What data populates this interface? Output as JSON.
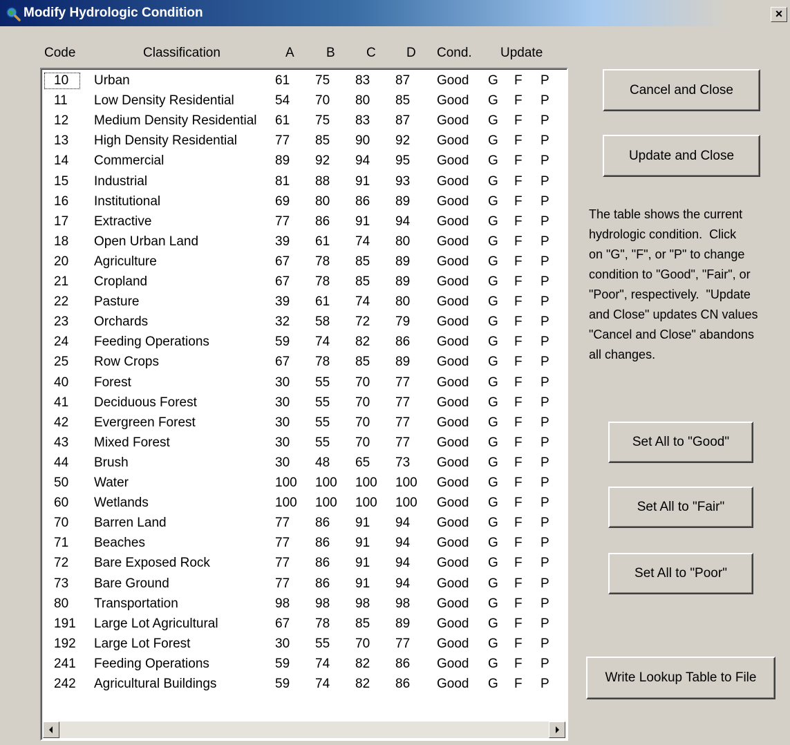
{
  "window": {
    "title": "Modify Hydrologic Condition",
    "close_glyph": "×",
    "icon": "globe-magnifier-icon"
  },
  "columns": {
    "code": "Code",
    "classification": "Classification",
    "a": "A",
    "b": "B",
    "c": "C",
    "d": "D",
    "cond": "Cond.",
    "update": "Update"
  },
  "rows": [
    {
      "code": "10",
      "name": "Urban",
      "a": "61",
      "b": "75",
      "c": "83",
      "d": "87",
      "cond": "Good",
      "g": "G",
      "f": "F",
      "p": "P"
    },
    {
      "code": "11",
      "name": "Low Density Residential",
      "a": "54",
      "b": "70",
      "c": "80",
      "d": "85",
      "cond": "Good",
      "g": "G",
      "f": "F",
      "p": "P"
    },
    {
      "code": "12",
      "name": "Medium Density Residential",
      "a": "61",
      "b": "75",
      "c": "83",
      "d": "87",
      "cond": "Good",
      "g": "G",
      "f": "F",
      "p": "P"
    },
    {
      "code": "13",
      "name": "High Density Residential",
      "a": "77",
      "b": "85",
      "c": "90",
      "d": "92",
      "cond": "Good",
      "g": "G",
      "f": "F",
      "p": "P"
    },
    {
      "code": "14",
      "name": "Commercial",
      "a": "89",
      "b": "92",
      "c": "94",
      "d": "95",
      "cond": "Good",
      "g": "G",
      "f": "F",
      "p": "P"
    },
    {
      "code": "15",
      "name": "Industrial",
      "a": "81",
      "b": "88",
      "c": "91",
      "d": "93",
      "cond": "Good",
      "g": "G",
      "f": "F",
      "p": "P"
    },
    {
      "code": "16",
      "name": "Institutional",
      "a": "69",
      "b": "80",
      "c": "86",
      "d": "89",
      "cond": "Good",
      "g": "G",
      "f": "F",
      "p": "P"
    },
    {
      "code": "17",
      "name": "Extractive",
      "a": "77",
      "b": "86",
      "c": "91",
      "d": "94",
      "cond": "Good",
      "g": "G",
      "f": "F",
      "p": "P"
    },
    {
      "code": "18",
      "name": "Open Urban Land",
      "a": "39",
      "b": "61",
      "c": "74",
      "d": "80",
      "cond": "Good",
      "g": "G",
      "f": "F",
      "p": "P"
    },
    {
      "code": "20",
      "name": "Agriculture",
      "a": "67",
      "b": "78",
      "c": "85",
      "d": "89",
      "cond": "Good",
      "g": "G",
      "f": "F",
      "p": "P"
    },
    {
      "code": "21",
      "name": "Cropland",
      "a": "67",
      "b": "78",
      "c": "85",
      "d": "89",
      "cond": "Good",
      "g": "G",
      "f": "F",
      "p": "P"
    },
    {
      "code": "22",
      "name": "Pasture",
      "a": "39",
      "b": "61",
      "c": "74",
      "d": "80",
      "cond": "Good",
      "g": "G",
      "f": "F",
      "p": "P"
    },
    {
      "code": "23",
      "name": "Orchards",
      "a": "32",
      "b": "58",
      "c": "72",
      "d": "79",
      "cond": "Good",
      "g": "G",
      "f": "F",
      "p": "P"
    },
    {
      "code": "24",
      "name": "Feeding Operations",
      "a": "59",
      "b": "74",
      "c": "82",
      "d": "86",
      "cond": "Good",
      "g": "G",
      "f": "F",
      "p": "P"
    },
    {
      "code": "25",
      "name": "Row Crops",
      "a": "67",
      "b": "78",
      "c": "85",
      "d": "89",
      "cond": "Good",
      "g": "G",
      "f": "F",
      "p": "P"
    },
    {
      "code": "40",
      "name": "Forest",
      "a": "30",
      "b": "55",
      "c": "70",
      "d": "77",
      "cond": "Good",
      "g": "G",
      "f": "F",
      "p": "P"
    },
    {
      "code": "41",
      "name": "Deciduous Forest",
      "a": "30",
      "b": "55",
      "c": "70",
      "d": "77",
      "cond": "Good",
      "g": "G",
      "f": "F",
      "p": "P"
    },
    {
      "code": "42",
      "name": "Evergreen Forest",
      "a": "30",
      "b": "55",
      "c": "70",
      "d": "77",
      "cond": "Good",
      "g": "G",
      "f": "F",
      "p": "P"
    },
    {
      "code": "43",
      "name": "Mixed Forest",
      "a": "30",
      "b": "55",
      "c": "70",
      "d": "77",
      "cond": "Good",
      "g": "G",
      "f": "F",
      "p": "P"
    },
    {
      "code": "44",
      "name": "Brush",
      "a": "30",
      "b": "48",
      "c": "65",
      "d": "73",
      "cond": "Good",
      "g": "G",
      "f": "F",
      "p": "P"
    },
    {
      "code": "50",
      "name": "Water",
      "a": "100",
      "b": "100",
      "c": "100",
      "d": "100",
      "cond": "Good",
      "g": "G",
      "f": "F",
      "p": "P"
    },
    {
      "code": "60",
      "name": "Wetlands",
      "a": "100",
      "b": "100",
      "c": "100",
      "d": "100",
      "cond": "Good",
      "g": "G",
      "f": "F",
      "p": "P"
    },
    {
      "code": "70",
      "name": "Barren Land",
      "a": "77",
      "b": "86",
      "c": "91",
      "d": "94",
      "cond": "Good",
      "g": "G",
      "f": "F",
      "p": "P"
    },
    {
      "code": "71",
      "name": "Beaches",
      "a": "77",
      "b": "86",
      "c": "91",
      "d": "94",
      "cond": "Good",
      "g": "G",
      "f": "F",
      "p": "P"
    },
    {
      "code": "72",
      "name": "Bare Exposed Rock",
      "a": "77",
      "b": "86",
      "c": "91",
      "d": "94",
      "cond": "Good",
      "g": "G",
      "f": "F",
      "p": "P"
    },
    {
      "code": "73",
      "name": "Bare Ground",
      "a": "77",
      "b": "86",
      "c": "91",
      "d": "94",
      "cond": "Good",
      "g": "G",
      "f": "F",
      "p": "P"
    },
    {
      "code": "80",
      "name": "Transportation",
      "a": "98",
      "b": "98",
      "c": "98",
      "d": "98",
      "cond": "Good",
      "g": "G",
      "f": "F",
      "p": "P"
    },
    {
      "code": "191",
      "name": "Large Lot Agricultural",
      "a": "67",
      "b": "78",
      "c": "85",
      "d": "89",
      "cond": "Good",
      "g": "G",
      "f": "F",
      "p": "P"
    },
    {
      "code": "192",
      "name": "Large Lot Forest",
      "a": "30",
      "b": "55",
      "c": "70",
      "d": "77",
      "cond": "Good",
      "g": "G",
      "f": "F",
      "p": "P"
    },
    {
      "code": "241",
      "name": "Feeding Operations",
      "a": "59",
      "b": "74",
      "c": "82",
      "d": "86",
      "cond": "Good",
      "g": "G",
      "f": "F",
      "p": "P"
    },
    {
      "code": "242",
      "name": "Agricultural Buildings",
      "a": "59",
      "b": "74",
      "c": "82",
      "d": "86",
      "cond": "Good",
      "g": "G",
      "f": "F",
      "p": "P"
    }
  ],
  "buttons": {
    "cancel_close": "Cancel and Close",
    "update_close": "Update and Close",
    "set_good": "Set All to \"Good\"",
    "set_fair": "Set All to \"Fair\"",
    "set_poor": "Set All to \"Poor\"",
    "write_lookup": "Write Lookup Table to File"
  },
  "help_lines": [
    "The table shows the current",
    "hydrologic condition.  Click",
    "on \"G\", \"F\", or \"P\" to change",
    "condition to \"Good\", \"Fair\", or",
    "\"Poor\", respectively.  \"Update",
    "and Close\" updates CN values",
    "\"Cancel and Close\" abandons",
    "all changes."
  ],
  "scrollbar": {
    "left_icon": "arrow-left-icon",
    "right_icon": "arrow-right-icon"
  }
}
